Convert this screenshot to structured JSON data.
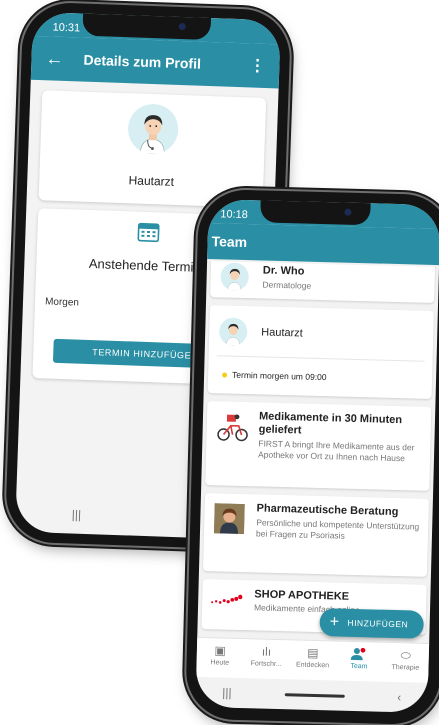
{
  "back_screen": {
    "status_time": "10:31",
    "app_title": "Details zum Profil",
    "profile_name": "Hautarzt",
    "appointments_title": "Anstehende Termine",
    "appointment_when": "Morgen",
    "add_appointment_label": "TERMIN HINZUFÜGEN"
  },
  "front_screen": {
    "status_time": "10:18",
    "app_title": "Team",
    "cards": [
      {
        "title": "Dr. Who",
        "subtitle": "Dermatologe"
      },
      {
        "title": "Hautarzt",
        "note": "Termin morgen um 09:00"
      },
      {
        "title": "Medikamente in 30 Minuten geliefert",
        "subtitle": "FIRST A bringt Ihre Medikamente aus der Apotheke vor Ort zu Ihnen nach Hause"
      },
      {
        "title": "Pharmazeutische Beratung",
        "subtitle": "Persönliche und kompetente Unterstützung bei Fragen zu Psoriasis"
      },
      {
        "title": "SHOP APOTHEKE",
        "subtitle": "Medikamente einfach online"
      }
    ],
    "fab_label": "HINZUFÜGEN",
    "nav": [
      {
        "label": "Heute",
        "icon": "clipboard-icon"
      },
      {
        "label": "Fortschr...",
        "icon": "bar-chart-icon"
      },
      {
        "label": "Entdecken",
        "icon": "book-icon"
      },
      {
        "label": "Team",
        "icon": "team-icon"
      },
      {
        "label": "Therapie",
        "icon": "pill-icon"
      }
    ]
  },
  "colors": {
    "primary": "#2a8fa4",
    "accent_dot": "#f3cf1b"
  }
}
